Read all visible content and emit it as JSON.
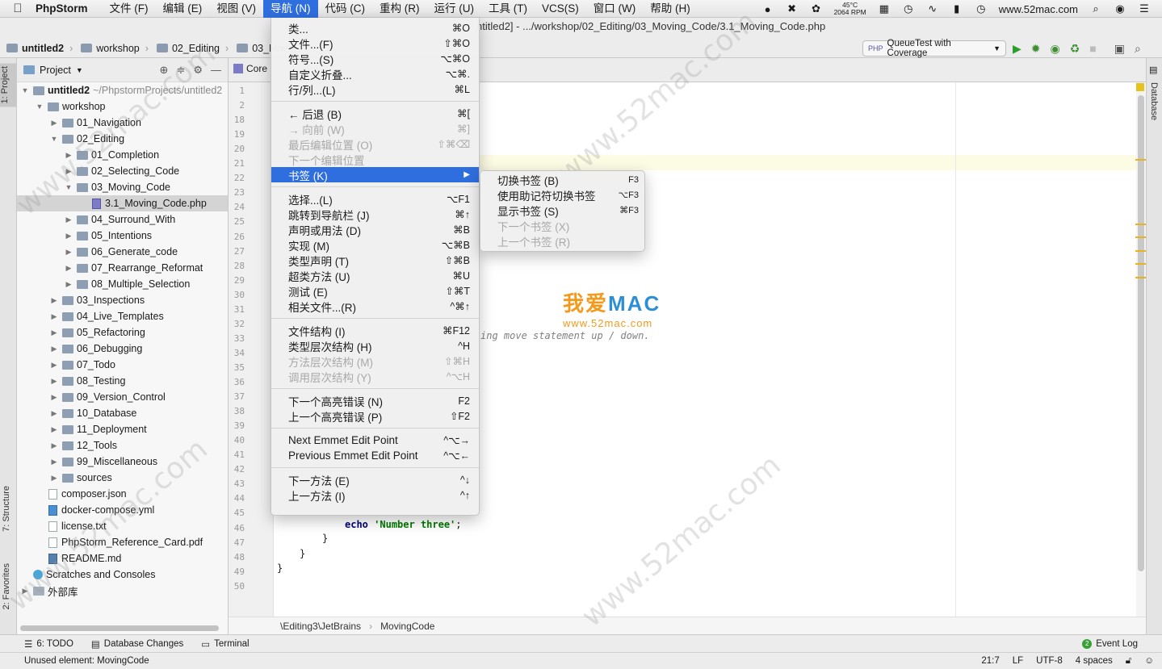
{
  "menubar": {
    "app": "PhpStorm",
    "items": [
      "文件 (F)",
      "编辑 (E)",
      "视图 (V)",
      "导航 (N)",
      "代码 (C)",
      "重构 (R)",
      "运行 (U)",
      "工具 (T)",
      "VCS(S)",
      "窗口 (W)",
      "帮助 (H)"
    ],
    "active_index": 3,
    "temp_top": "45°C",
    "temp_bottom": "2064 RPM",
    "site": "www.52mac.com"
  },
  "window_title": "ntitled2] - .../workshop/02_Editing/03_Moving_Code/3.1_Moving_Code.php",
  "breadcrumbs": [
    "untitled2",
    "workshop",
    "02_Editing",
    "03_Movin"
  ],
  "run_config": "QueueTest with Coverage",
  "project_panel": {
    "title": "Project",
    "root_label": "untitled2",
    "root_path": "~/PhpstormProjects/untitled2"
  },
  "tree": [
    {
      "label": "workshop",
      "indent": 1,
      "type": "folder",
      "open": true
    },
    {
      "label": "01_Navigation",
      "indent": 2,
      "type": "folder"
    },
    {
      "label": "02_Editing",
      "indent": 2,
      "type": "folder",
      "open": true
    },
    {
      "label": "01_Completion",
      "indent": 3,
      "type": "folder"
    },
    {
      "label": "02_Selecting_Code",
      "indent": 3,
      "type": "folder"
    },
    {
      "label": "03_Moving_Code",
      "indent": 3,
      "type": "folder",
      "open": true
    },
    {
      "label": "3.1_Moving_Code.php",
      "indent": 4,
      "type": "php",
      "selected": true
    },
    {
      "label": "04_Surround_With",
      "indent": 3,
      "type": "folder"
    },
    {
      "label": "05_Intentions",
      "indent": 3,
      "type": "folder"
    },
    {
      "label": "06_Generate_code",
      "indent": 3,
      "type": "folder"
    },
    {
      "label": "07_Rearrange_Reformat",
      "indent": 3,
      "type": "folder"
    },
    {
      "label": "08_Multiple_Selection",
      "indent": 3,
      "type": "folder"
    },
    {
      "label": "03_Inspections",
      "indent": 2,
      "type": "folder"
    },
    {
      "label": "04_Live_Templates",
      "indent": 2,
      "type": "folder"
    },
    {
      "label": "05_Refactoring",
      "indent": 2,
      "type": "folder"
    },
    {
      "label": "06_Debugging",
      "indent": 2,
      "type": "folder"
    },
    {
      "label": "07_Todo",
      "indent": 2,
      "type": "folder"
    },
    {
      "label": "08_Testing",
      "indent": 2,
      "type": "folder"
    },
    {
      "label": "09_Version_Control",
      "indent": 2,
      "type": "folder"
    },
    {
      "label": "10_Database",
      "indent": 2,
      "type": "folder"
    },
    {
      "label": "11_Deployment",
      "indent": 2,
      "type": "folder"
    },
    {
      "label": "12_Tools",
      "indent": 2,
      "type": "folder"
    },
    {
      "label": "99_Miscellaneous",
      "indent": 2,
      "type": "folder"
    },
    {
      "label": "sources",
      "indent": 2,
      "type": "folder"
    },
    {
      "label": "composer.json",
      "indent": 1,
      "type": "file"
    },
    {
      "label": "docker-compose.yml",
      "indent": 1,
      "type": "dc"
    },
    {
      "label": "license.txt",
      "indent": 1,
      "type": "file"
    },
    {
      "label": "PhpStorm_Reference_Card.pdf",
      "indent": 1,
      "type": "file"
    },
    {
      "label": "README.md",
      "indent": 1,
      "type": "md"
    },
    {
      "label": "Scratches and Consoles",
      "indent": 0,
      "type": "scratch"
    },
    {
      "label": "外部库",
      "indent": 0,
      "type": "lib"
    }
  ],
  "editor_tab": "Core",
  "line_numbers": [
    "1",
    "2",
    "18",
    "19",
    "20",
    "21",
    "22",
    "23",
    "24",
    "25",
    "26",
    "27",
    "28",
    "29",
    "30",
    "31",
    "32",
    "33",
    "34",
    "35",
    "36",
    "37",
    "38",
    "39",
    "40",
    "41",
    "42",
    "43",
    "44",
    "45",
    "46",
    "47",
    "48",
    "49",
    "50"
  ],
  "code": {
    "comment_fragment": "ing move statement up / down.",
    "echo_kw": "echo",
    "echo_str": "'Number three'",
    "semicolon": ";",
    "brace1": "}",
    "brace2": "}",
    "brace3": "}"
  },
  "nav_menu": [
    {
      "label": "类...",
      "shortcut": "⌘O"
    },
    {
      "label": "文件...(F)",
      "shortcut": "⇧⌘O"
    },
    {
      "label": "符号...(S)",
      "shortcut": "⌥⌘O"
    },
    {
      "label": "自定义折叠...",
      "shortcut": "⌥⌘."
    },
    {
      "label": "行/列...(L)",
      "shortcut": "⌘L"
    },
    {
      "sep": true
    },
    {
      "label": "← 后退 (B)",
      "shortcut": "⌘["
    },
    {
      "label": "→ 向前 (W)",
      "shortcut": "⌘]",
      "disabled": true
    },
    {
      "label": "最后编辑位置 (O)",
      "shortcut": "⇧⌘⌫",
      "disabled": true
    },
    {
      "label": "下一个编辑位置",
      "shortcut": "",
      "disabled": true
    },
    {
      "label": "书签 (K)",
      "shortcut": "",
      "highlighted": true,
      "submenu": true
    },
    {
      "sep": true
    },
    {
      "label": "选择...(L)",
      "shortcut": "⌥F1"
    },
    {
      "label": "跳转到导航栏 (J)",
      "shortcut": "⌘↑"
    },
    {
      "label": "声明或用法 (D)",
      "shortcut": "⌘B"
    },
    {
      "label": "实现 (M)",
      "shortcut": "⌥⌘B"
    },
    {
      "label": "类型声明 (T)",
      "shortcut": "⇧⌘B"
    },
    {
      "label": "超类方法 (U)",
      "shortcut": "⌘U"
    },
    {
      "label": "测试 (E)",
      "shortcut": "⇧⌘T"
    },
    {
      "label": "相关文件...(R)",
      "shortcut": "^⌘↑"
    },
    {
      "sep": true
    },
    {
      "label": "文件结构 (I)",
      "shortcut": "⌘F12"
    },
    {
      "label": "类型层次结构 (H)",
      "shortcut": "^H"
    },
    {
      "label": "方法层次结构 (M)",
      "shortcut": "⇧⌘H",
      "disabled": true
    },
    {
      "label": "调用层次结构 (Y)",
      "shortcut": "^⌥H",
      "disabled": true
    },
    {
      "sep": true
    },
    {
      "label": "下一个高亮错误 (N)",
      "shortcut": "F2"
    },
    {
      "label": "上一个高亮错误 (P)",
      "shortcut": "⇧F2"
    },
    {
      "sep": true
    },
    {
      "label": "Next Emmet Edit Point",
      "shortcut": "^⌥→"
    },
    {
      "label": "Previous Emmet Edit Point",
      "shortcut": "^⌥←"
    },
    {
      "sep": true
    },
    {
      "label": "下一方法 (E)",
      "shortcut": "^↓"
    },
    {
      "label": "上一方法 (I)",
      "shortcut": "^↑"
    }
  ],
  "bookmark_submenu": [
    {
      "label": "切换书签 (B)",
      "shortcut": "F3"
    },
    {
      "label": "使用助记符切换书签",
      "shortcut": "⌥F3"
    },
    {
      "label": "显示书签 (S)",
      "shortcut": "⌘F3"
    },
    {
      "label": "下一个书签 (X)",
      "shortcut": "",
      "disabled": true
    },
    {
      "label": "上一个书签 (R)",
      "shortcut": "",
      "disabled": true
    }
  ],
  "editor_breadcrumb": [
    "\\Editing3\\JetBrains",
    "MovingCode"
  ],
  "bottom_tools": {
    "todo": "6: TODO",
    "db_changes": "Database Changes",
    "terminal": "Terminal",
    "event_log": "Event Log",
    "event_count": "2"
  },
  "statusbar": {
    "message": "Unused element: MovingCode",
    "position": "21:7",
    "line_sep": "LF",
    "encoding": "UTF-8",
    "indent": "4 spaces"
  },
  "stripes": {
    "project": "1: Project",
    "structure": "7: Structure",
    "favorites": "2: Favorites",
    "database": "Database"
  },
  "logo": {
    "cn": "我爱",
    "mac": "MAC",
    "url": "www.52mac.com"
  }
}
